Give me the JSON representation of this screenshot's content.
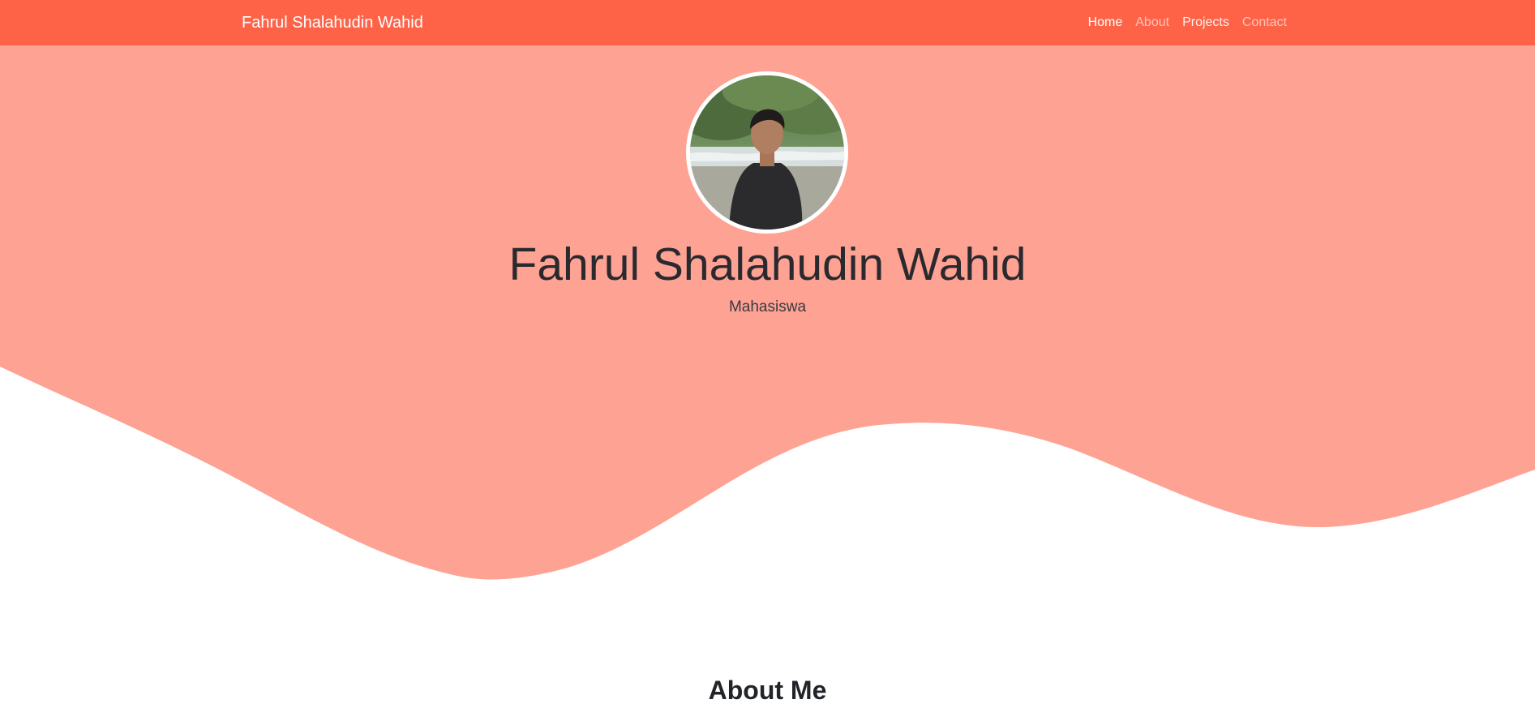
{
  "navbar": {
    "brand": "Fahrul Shalahudin Wahid",
    "links": [
      {
        "label": "Home"
      },
      {
        "label": "About"
      },
      {
        "label": "Projects"
      },
      {
        "label": "Contact"
      }
    ]
  },
  "hero": {
    "name": "Fahrul Shalahudin Wahid",
    "role": "Mahasiswa"
  },
  "about": {
    "title": "About Me"
  },
  "colors": {
    "navbar": "#ff6347",
    "hero": "#fea293",
    "text": "#212529"
  }
}
